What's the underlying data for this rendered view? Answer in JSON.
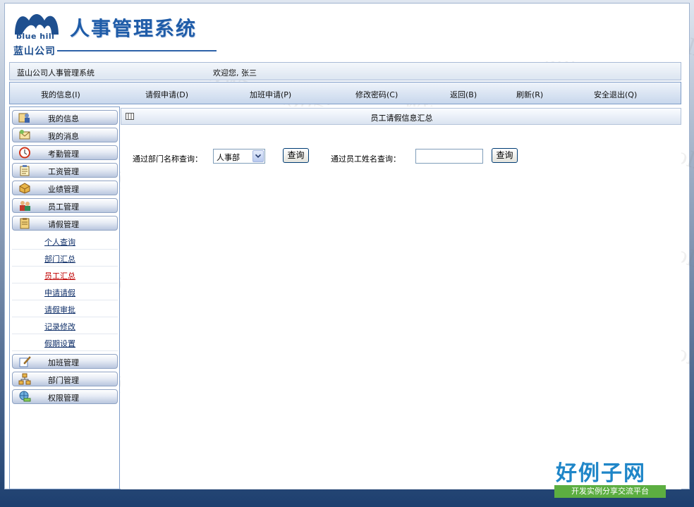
{
  "header": {
    "logo_en": "blue hill",
    "logo_cn": "蓝山公司",
    "system_title": "人事管理系统"
  },
  "status": {
    "company_system": "蓝山公司人事管理系统",
    "welcome": "欢迎您, 张三"
  },
  "nav": [
    {
      "label": "我的信息(I)"
    },
    {
      "label": "请假申请(D)"
    },
    {
      "label": "加班申请(P)"
    },
    {
      "label": "修改密码(C)"
    },
    {
      "label": "返回(B)"
    },
    {
      "label": "刷新(R)"
    },
    {
      "label": "安全退出(Q)"
    }
  ],
  "sidebar": {
    "top_menu": [
      {
        "label": "我的信息",
        "icon": "person-info-icon"
      },
      {
        "label": "我的消息",
        "icon": "message-icon"
      },
      {
        "label": "考勤管理",
        "icon": "clock-icon"
      },
      {
        "label": "工资管理",
        "icon": "notepad-icon"
      },
      {
        "label": "业绩管理",
        "icon": "box-icon"
      },
      {
        "label": "员工管理",
        "icon": "people-icon"
      },
      {
        "label": "请假管理",
        "icon": "clipboard-icon"
      }
    ],
    "leave_sub": [
      {
        "label": "个人查询"
      },
      {
        "label": "部门汇总"
      },
      {
        "label": "员工汇总"
      },
      {
        "label": "申请请假"
      },
      {
        "label": "请假审批"
      },
      {
        "label": "记录修改"
      },
      {
        "label": "假期设置"
      }
    ],
    "bottom_menu": [
      {
        "label": "加班管理",
        "icon": "pencil-paper-icon"
      },
      {
        "label": "部门管理",
        "icon": "org-icon"
      },
      {
        "label": "权限管理",
        "icon": "globe-key-icon"
      }
    ]
  },
  "main": {
    "title": "员工请假信息汇总",
    "dept_query_label": "通过部门名称查询：",
    "dept_selected": "人事部",
    "query_button": "查询",
    "name_query_label": "通过员工姓名查询：",
    "name_value": ""
  },
  "watermark": "www.haolizi.com",
  "brand": {
    "name": "好例子网",
    "slogan": "开发实例分享交流平台"
  },
  "colors": {
    "title_blue": "#1f5ca8",
    "nav_border": "#7f9dc8",
    "active_link": "#c00000",
    "brand_green": "#5cae41"
  }
}
